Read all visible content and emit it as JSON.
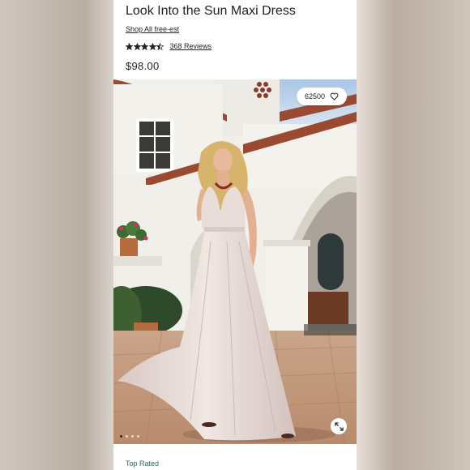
{
  "product": {
    "title": "Look Into the Sun Maxi Dress",
    "brand_link": "Shop All free-est",
    "rating": 4.5,
    "rating_max": 5,
    "reviews_label": "368 Reviews",
    "price": "$98.00"
  },
  "gallery": {
    "favorites_count": "62500",
    "image_count": 4,
    "active_index": 0
  },
  "footer": {
    "badge": "Top Rated"
  },
  "colors": {
    "text": "#1f1f1f",
    "badge_green": "#2f6b5a",
    "wall": "#f1efe9",
    "roof_tile": "#9b4a32",
    "sky": "#bcd3ea",
    "dress": "#e6d9d5"
  },
  "icons": [
    "star-icon",
    "heart-icon",
    "expand-icon"
  ]
}
